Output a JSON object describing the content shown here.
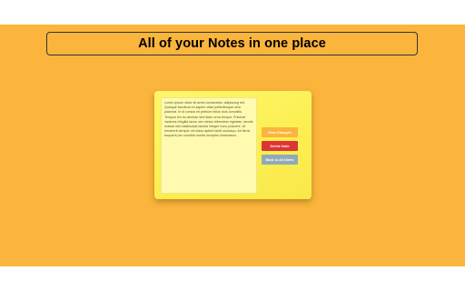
{
  "header": {
    "title": "All of your Notes in one place"
  },
  "note": {
    "text": "Lorem ipsum dolor sit amet consectetur adipiscing elit. Quisque faucibus ex sapien vitae pellentesque sem placerat. In id cursus mi pretium tellus duis convallis. Tempus leo eu aenean sed diam urna tempor. Pulvinar vivamus fringilla lacus nec metus bibendum egestas. Iaculis massa nisl malesuada lacinia integer nunc posuere. Ut hendrerit semper vel class aptent taciti sociosqu. Ad litora torquent per conubia nostra inceptos himenaeos."
  },
  "actions": {
    "save_label": "Save Changes",
    "delete_label": "Delete Note",
    "back_label": "Back to All Notes"
  },
  "colors": {
    "background": "#fbb53c",
    "note": "#fef76a",
    "save": "#fbb53c",
    "delete": "#dc3535",
    "back": "#8faab8"
  }
}
